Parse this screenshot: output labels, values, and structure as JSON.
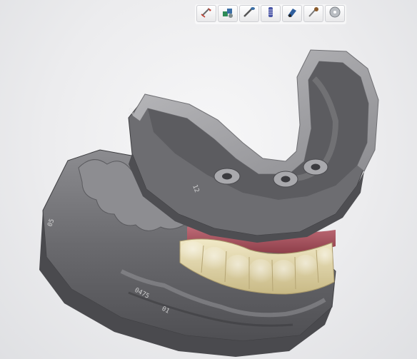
{
  "toolbar": {
    "buttons": [
      {
        "icon": "cut-model-icon",
        "color": "#c0392b"
      },
      {
        "icon": "model-components-icon",
        "color": "#2e8b57"
      },
      {
        "icon": "attach-tool-icon",
        "color": "#3a6ea5"
      },
      {
        "icon": "implant-analog-icon",
        "color": "#4a56a6"
      },
      {
        "icon": "scan-body-icon",
        "color": "#2f5f9e"
      },
      {
        "icon": "sculpt-tool-icon",
        "color": "#8a5a2b"
      },
      {
        "icon": "disc-icon",
        "color": "#9aa0a6"
      }
    ]
  },
  "viewport": {
    "background": "#ececee",
    "model_colors": {
      "stone": "#6f6f72",
      "stone_highlight": "#a9a9ac",
      "teeth": "#e6dcb0",
      "gingiva": "#b25a64"
    }
  }
}
